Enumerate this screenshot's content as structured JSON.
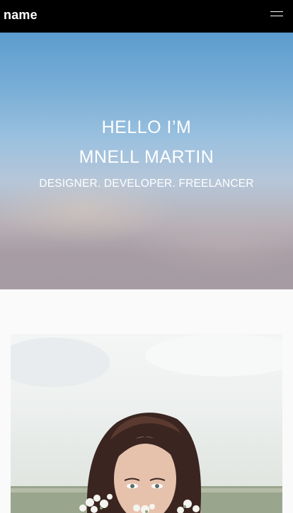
{
  "navbar": {
    "brand": "name",
    "menu_icon": "hamburger-icon"
  },
  "hero": {
    "line1": "HELLO I’M",
    "line2": "MNELL MARTIN",
    "tagline": "DESIGNER. DEVELOPER. FREELANCER"
  },
  "about": {
    "photo": "portrait-photo-woman-with-flowers"
  },
  "colors": {
    "navbar": "#000000",
    "hero_top": "#5c9ccf",
    "hero_bottom": "#a69ba3",
    "page_bg": "#fafafa"
  }
}
